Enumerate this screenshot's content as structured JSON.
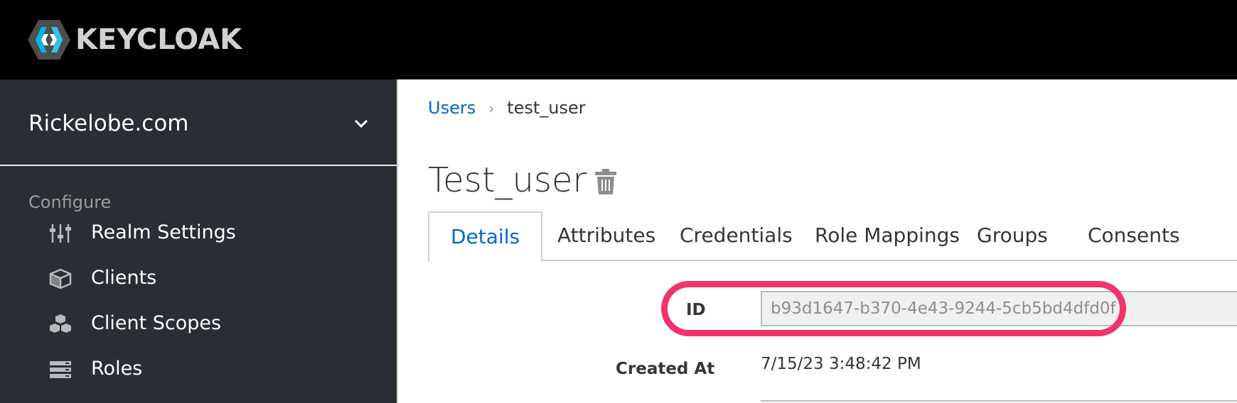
{
  "header": {
    "brand": "KEYCLOAK",
    "logo_icon": "keycloak-logo-icon"
  },
  "sidebar": {
    "realm_name": "Rickelobe.com",
    "section_label": "Configure",
    "items": [
      {
        "label": "Realm Settings",
        "icon": "sliders-icon"
      },
      {
        "label": "Clients",
        "icon": "cube-icon"
      },
      {
        "label": "Client Scopes",
        "icon": "cubes-icon"
      },
      {
        "label": "Roles",
        "icon": "server-icon"
      }
    ]
  },
  "breadcrumb": {
    "parent": "Users",
    "separator": "›",
    "current": "test_user"
  },
  "page": {
    "title": "Test_user"
  },
  "tabs": [
    {
      "label": "Details",
      "active": true
    },
    {
      "label": "Attributes"
    },
    {
      "label": "Credentials"
    },
    {
      "label": "Role Mappings"
    },
    {
      "label": "Groups"
    },
    {
      "label": "Consents"
    }
  ],
  "form": {
    "id_label": "ID",
    "id_value": "b93d1647-b370-4e43-9244-5cb5bd4dfd0f",
    "created_label": "Created At",
    "created_value": "7/15/23 3:48:42 PM"
  },
  "colors": {
    "link": "#0066cc",
    "highlight": "#f2336b",
    "sidebar_bg": "#292e34",
    "topbar_bg": "#000000"
  }
}
